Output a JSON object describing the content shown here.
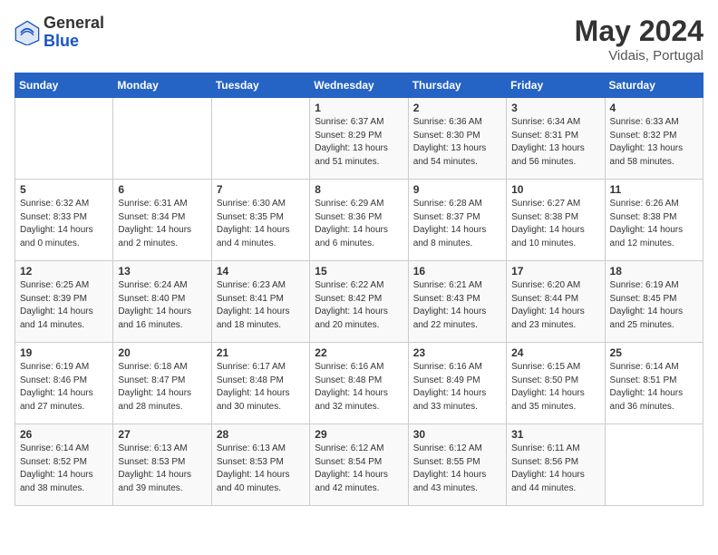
{
  "header": {
    "logo_general": "General",
    "logo_blue": "Blue",
    "month_year": "May 2024",
    "location": "Vidais, Portugal"
  },
  "weekdays": [
    "Sunday",
    "Monday",
    "Tuesday",
    "Wednesday",
    "Thursday",
    "Friday",
    "Saturday"
  ],
  "weeks": [
    [
      {
        "day": "",
        "info": ""
      },
      {
        "day": "",
        "info": ""
      },
      {
        "day": "",
        "info": ""
      },
      {
        "day": "1",
        "info": "Sunrise: 6:37 AM\nSunset: 8:29 PM\nDaylight: 13 hours\nand 51 minutes."
      },
      {
        "day": "2",
        "info": "Sunrise: 6:36 AM\nSunset: 8:30 PM\nDaylight: 13 hours\nand 54 minutes."
      },
      {
        "day": "3",
        "info": "Sunrise: 6:34 AM\nSunset: 8:31 PM\nDaylight: 13 hours\nand 56 minutes."
      },
      {
        "day": "4",
        "info": "Sunrise: 6:33 AM\nSunset: 8:32 PM\nDaylight: 13 hours\nand 58 minutes."
      }
    ],
    [
      {
        "day": "5",
        "info": "Sunrise: 6:32 AM\nSunset: 8:33 PM\nDaylight: 14 hours\nand 0 minutes."
      },
      {
        "day": "6",
        "info": "Sunrise: 6:31 AM\nSunset: 8:34 PM\nDaylight: 14 hours\nand 2 minutes."
      },
      {
        "day": "7",
        "info": "Sunrise: 6:30 AM\nSunset: 8:35 PM\nDaylight: 14 hours\nand 4 minutes."
      },
      {
        "day": "8",
        "info": "Sunrise: 6:29 AM\nSunset: 8:36 PM\nDaylight: 14 hours\nand 6 minutes."
      },
      {
        "day": "9",
        "info": "Sunrise: 6:28 AM\nSunset: 8:37 PM\nDaylight: 14 hours\nand 8 minutes."
      },
      {
        "day": "10",
        "info": "Sunrise: 6:27 AM\nSunset: 8:38 PM\nDaylight: 14 hours\nand 10 minutes."
      },
      {
        "day": "11",
        "info": "Sunrise: 6:26 AM\nSunset: 8:38 PM\nDaylight: 14 hours\nand 12 minutes."
      }
    ],
    [
      {
        "day": "12",
        "info": "Sunrise: 6:25 AM\nSunset: 8:39 PM\nDaylight: 14 hours\nand 14 minutes."
      },
      {
        "day": "13",
        "info": "Sunrise: 6:24 AM\nSunset: 8:40 PM\nDaylight: 14 hours\nand 16 minutes."
      },
      {
        "day": "14",
        "info": "Sunrise: 6:23 AM\nSunset: 8:41 PM\nDaylight: 14 hours\nand 18 minutes."
      },
      {
        "day": "15",
        "info": "Sunrise: 6:22 AM\nSunset: 8:42 PM\nDaylight: 14 hours\nand 20 minutes."
      },
      {
        "day": "16",
        "info": "Sunrise: 6:21 AM\nSunset: 8:43 PM\nDaylight: 14 hours\nand 22 minutes."
      },
      {
        "day": "17",
        "info": "Sunrise: 6:20 AM\nSunset: 8:44 PM\nDaylight: 14 hours\nand 23 minutes."
      },
      {
        "day": "18",
        "info": "Sunrise: 6:19 AM\nSunset: 8:45 PM\nDaylight: 14 hours\nand 25 minutes."
      }
    ],
    [
      {
        "day": "19",
        "info": "Sunrise: 6:19 AM\nSunset: 8:46 PM\nDaylight: 14 hours\nand 27 minutes."
      },
      {
        "day": "20",
        "info": "Sunrise: 6:18 AM\nSunset: 8:47 PM\nDaylight: 14 hours\nand 28 minutes."
      },
      {
        "day": "21",
        "info": "Sunrise: 6:17 AM\nSunset: 8:48 PM\nDaylight: 14 hours\nand 30 minutes."
      },
      {
        "day": "22",
        "info": "Sunrise: 6:16 AM\nSunset: 8:48 PM\nDaylight: 14 hours\nand 32 minutes."
      },
      {
        "day": "23",
        "info": "Sunrise: 6:16 AM\nSunset: 8:49 PM\nDaylight: 14 hours\nand 33 minutes."
      },
      {
        "day": "24",
        "info": "Sunrise: 6:15 AM\nSunset: 8:50 PM\nDaylight: 14 hours\nand 35 minutes."
      },
      {
        "day": "25",
        "info": "Sunrise: 6:14 AM\nSunset: 8:51 PM\nDaylight: 14 hours\nand 36 minutes."
      }
    ],
    [
      {
        "day": "26",
        "info": "Sunrise: 6:14 AM\nSunset: 8:52 PM\nDaylight: 14 hours\nand 38 minutes."
      },
      {
        "day": "27",
        "info": "Sunrise: 6:13 AM\nSunset: 8:53 PM\nDaylight: 14 hours\nand 39 minutes."
      },
      {
        "day": "28",
        "info": "Sunrise: 6:13 AM\nSunset: 8:53 PM\nDaylight: 14 hours\nand 40 minutes."
      },
      {
        "day": "29",
        "info": "Sunrise: 6:12 AM\nSunset: 8:54 PM\nDaylight: 14 hours\nand 42 minutes."
      },
      {
        "day": "30",
        "info": "Sunrise: 6:12 AM\nSunset: 8:55 PM\nDaylight: 14 hours\nand 43 minutes."
      },
      {
        "day": "31",
        "info": "Sunrise: 6:11 AM\nSunset: 8:56 PM\nDaylight: 14 hours\nand 44 minutes."
      },
      {
        "day": "",
        "info": ""
      }
    ]
  ]
}
